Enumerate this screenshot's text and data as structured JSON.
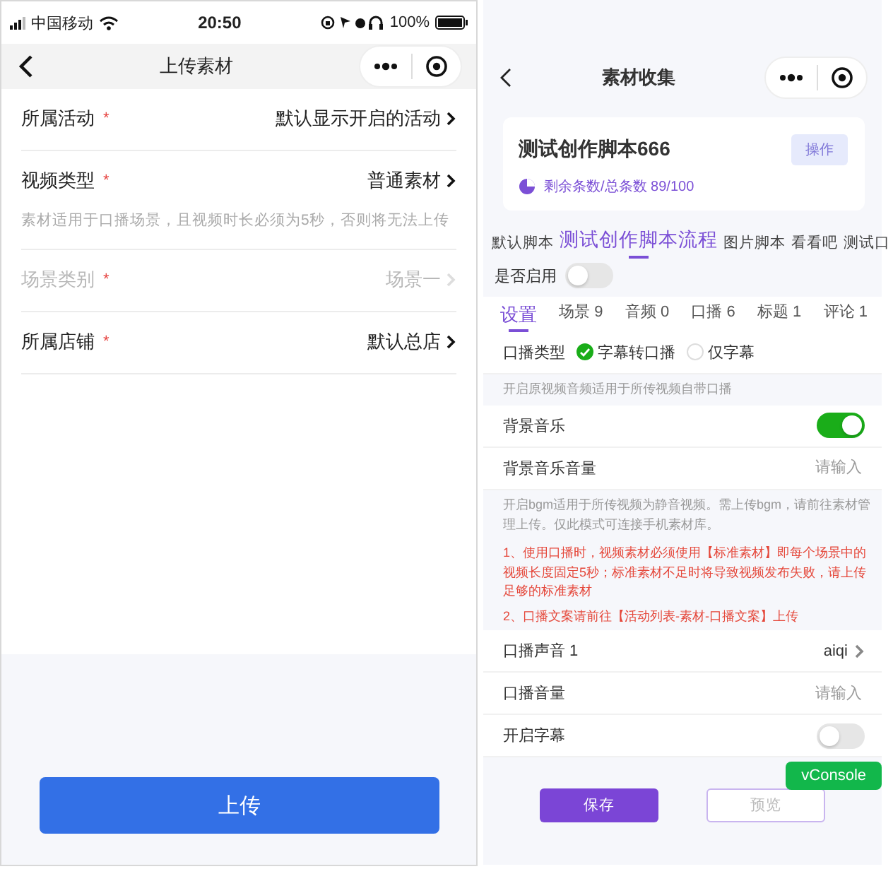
{
  "left": {
    "status_bar": {
      "carrier": "中国移动",
      "time": "20:50",
      "battery": "100%"
    },
    "nav": {
      "title": "上传素材"
    },
    "fields": [
      {
        "label": "所属活动",
        "required_mark": "*",
        "value": "默认显示开启的活动",
        "disabled": false
      },
      {
        "label": "视频类型",
        "required_mark": "*",
        "value": "普通素材",
        "disabled": false,
        "hint": "素材适用于口播场景，且视频时长必须为5秒，否则将无法上传"
      },
      {
        "label": "场景类别",
        "required_mark": "*",
        "value": "场景一",
        "disabled": true
      },
      {
        "label": "所属店铺",
        "required_mark": "*",
        "value": "默认总店",
        "disabled": false
      }
    ],
    "upload_button": "上传"
  },
  "right": {
    "nav": {
      "title": "素材收集"
    },
    "card": {
      "title": "测试创作脚本666",
      "action": "操作",
      "quota": "剩余条数/总条数 89/100"
    },
    "script_tabs": [
      {
        "label": "默认脚本",
        "selected": false
      },
      {
        "label": "测试创作脚本流程",
        "selected": true
      },
      {
        "label": "图片脚本",
        "selected": false
      },
      {
        "label": "看看吧",
        "selected": false
      },
      {
        "label": "测试口",
        "selected": false
      }
    ],
    "enable": {
      "label": "是否启用",
      "on": false
    },
    "sub_tabs": [
      {
        "label": "设置",
        "selected": true
      },
      {
        "label": "场景 9",
        "selected": false
      },
      {
        "label": "音频 0",
        "selected": false
      },
      {
        "label": "口播 6",
        "selected": false
      },
      {
        "label": "标题 1",
        "selected": false
      },
      {
        "label": "评论 1",
        "selected": false
      }
    ],
    "rows": [
      {
        "kind": "radio",
        "label": "口播类型",
        "options": [
          {
            "label": "字幕转口播",
            "selected": true
          },
          {
            "label": "仅字幕",
            "selected": false
          }
        ]
      },
      {
        "kind": "note",
        "text": "开启原视频音频适用于所传视频自带口播"
      },
      {
        "kind": "toggle",
        "label": "背景音乐",
        "on": true
      },
      {
        "kind": "input",
        "label": "背景音乐音量",
        "placeholder": "请输入"
      },
      {
        "kind": "note",
        "text": "开启bgm适用于所传视频为静音视频。需上传bgm，请前往素材管理上传。仅此模式可连接手机素材库。"
      },
      {
        "kind": "warning",
        "text": "1、使用口播时，视频素材必须使用【标准素材】即每个场景中的视频长度固定5秒；标准素材不足时将导致视频发布失败，请上传足够的标准素材"
      },
      {
        "kind": "warning",
        "text": "2、口播文案请前往【活动列表-素材-口播文案】上传"
      },
      {
        "kind": "select",
        "label": "口播声音  1",
        "value": "aiqi"
      },
      {
        "kind": "input",
        "label": "口播音量",
        "placeholder": "请输入"
      },
      {
        "kind": "toggle",
        "label": "开启字幕",
        "on": false
      }
    ],
    "buttons": [
      {
        "label": "保存",
        "kind": "primary"
      },
      {
        "label": "预览",
        "kind": "outline"
      }
    ],
    "badge": "vConsole"
  }
}
